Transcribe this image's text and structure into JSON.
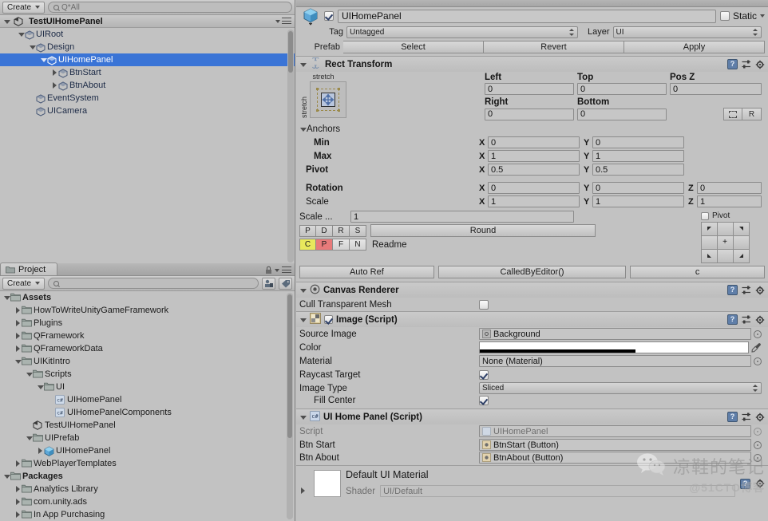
{
  "hierarchy": {
    "create_label": "Create",
    "search_placeholder": "Q*All",
    "root_label": "TestUIHomePanel",
    "items": [
      {
        "label": "UIRoot",
        "depth": 1,
        "arrow": "down",
        "selected": false,
        "icon": "gameobject"
      },
      {
        "label": "Design",
        "depth": 2,
        "arrow": "down",
        "selected": false,
        "icon": "gameobject"
      },
      {
        "label": "UIHomePanel",
        "depth": 3,
        "arrow": "down",
        "selected": true,
        "icon": "gameobject"
      },
      {
        "label": "BtnStart",
        "depth": 4,
        "arrow": "right",
        "selected": false,
        "icon": "gameobject"
      },
      {
        "label": "BtnAbout",
        "depth": 4,
        "arrow": "right",
        "selected": false,
        "icon": "gameobject"
      },
      {
        "label": "EventSystem",
        "depth": 2,
        "arrow": "none",
        "selected": false,
        "icon": "gameobject"
      },
      {
        "label": "UICamera",
        "depth": 2,
        "arrow": "none",
        "selected": false,
        "icon": "gameobject"
      }
    ]
  },
  "project": {
    "tab_label": "Project",
    "create_label": "Create",
    "search_placeholder": "",
    "items": [
      {
        "label": "Assets",
        "depth": 0,
        "arrow": "down",
        "icon": "folder",
        "bold": true
      },
      {
        "label": "HowToWriteUnityGameFramework",
        "depth": 1,
        "arrow": "right",
        "icon": "folder",
        "bold": false
      },
      {
        "label": "Plugins",
        "depth": 1,
        "arrow": "right",
        "icon": "folder",
        "bold": false
      },
      {
        "label": "QFramework",
        "depth": 1,
        "arrow": "right",
        "icon": "folder",
        "bold": false
      },
      {
        "label": "QFrameworkData",
        "depth": 1,
        "arrow": "right",
        "icon": "folder",
        "bold": false
      },
      {
        "label": "UIKitIntro",
        "depth": 1,
        "arrow": "down",
        "icon": "folder",
        "bold": false
      },
      {
        "label": "Scripts",
        "depth": 2,
        "arrow": "down",
        "icon": "folder",
        "bold": false
      },
      {
        "label": "UI",
        "depth": 3,
        "arrow": "down",
        "icon": "folder",
        "bold": false
      },
      {
        "label": "UIHomePanel",
        "depth": 4,
        "arrow": "none",
        "icon": "csharp",
        "bold": false
      },
      {
        "label": "UIHomePanelComponents",
        "depth": 4,
        "arrow": "none",
        "icon": "csharp",
        "bold": false
      },
      {
        "label": "TestUIHomePanel",
        "depth": 2,
        "arrow": "none",
        "icon": "scene",
        "bold": false
      },
      {
        "label": "UIPrefab",
        "depth": 2,
        "arrow": "down",
        "icon": "folder",
        "bold": false
      },
      {
        "label": "UIHomePanel",
        "depth": 3,
        "arrow": "right",
        "icon": "prefab",
        "bold": false
      },
      {
        "label": "WebPlayerTemplates",
        "depth": 1,
        "arrow": "right",
        "icon": "folder",
        "bold": false
      },
      {
        "label": "Packages",
        "depth": 0,
        "arrow": "down",
        "icon": "folder",
        "bold": true
      },
      {
        "label": "Analytics Library",
        "depth": 1,
        "arrow": "right",
        "icon": "folder",
        "bold": false
      },
      {
        "label": "com.unity.ads",
        "depth": 1,
        "arrow": "right",
        "icon": "folder",
        "bold": false
      },
      {
        "label": "In App Purchasing",
        "depth": 1,
        "arrow": "right",
        "icon": "folder",
        "bold": false
      }
    ]
  },
  "inspector": {
    "object_name": "UIHomePanel",
    "enabled": true,
    "static_label": "Static",
    "tag_label": "Tag",
    "tag_value": "Untagged",
    "layer_label": "Layer",
    "layer_value": "UI",
    "prefab_label": "Prefab",
    "prefab_buttons": [
      "Select",
      "Revert",
      "Apply"
    ],
    "rect_transform": {
      "title": "Rect Transform",
      "anchor_preset": "stretch",
      "anchor_preset_vertical": "stretch",
      "left_label": "Left",
      "left_value": "0",
      "top_label": "Top",
      "top_value": "0",
      "posz_label": "Pos Z",
      "posz_value": "0",
      "right_label": "Right",
      "right_value": "0",
      "bottom_label": "Bottom",
      "bottom_value": "0",
      "blueprint_label": "",
      "raw_label": "R",
      "anchors_label": "Anchors",
      "min_label": "Min",
      "min_x": "0",
      "min_y": "0",
      "max_label": "Max",
      "max_x": "1",
      "max_y": "1",
      "pivot_label": "Pivot",
      "pivot_x": "0.5",
      "pivot_y": "0.5",
      "rotation_label": "Rotation",
      "rot_x": "0",
      "rot_y": "0",
      "rot_z": "0",
      "scale_label": "Scale",
      "scale_x": "1",
      "scale_y": "1",
      "scale_z": "1"
    },
    "extra_tools": {
      "scale_label": "Scale ...",
      "scale_value": "1",
      "pdrs": [
        "P",
        "D",
        "R",
        "S"
      ],
      "round_label": "Round",
      "cpfn": [
        "C",
        "P",
        "F",
        "N"
      ],
      "readme_label": "Readme",
      "pivot_toggle_label": "Pivot",
      "auto_ref_label": "Auto Ref",
      "called_by_editor_label": "CalledByEditor()",
      "c_label": "c",
      "color_c": "#e8e85c",
      "color_p": "#e87a7a"
    },
    "canvas_renderer": {
      "title": "Canvas Renderer",
      "cull_label": "Cull Transparent Mesh",
      "cull_checked": false
    },
    "image_script": {
      "title": "Image (Script)",
      "enabled": true,
      "source_image_label": "Source Image",
      "source_image_value": "Background",
      "color_label": "Color",
      "color_value": "#FFFFFF",
      "material_label": "Material",
      "material_value": "None (Material)",
      "raycast_label": "Raycast Target",
      "raycast_checked": true,
      "image_type_label": "Image Type",
      "image_type_value": "Sliced",
      "fill_center_label": "Fill Center",
      "fill_center_checked": true
    },
    "ui_home_panel_script": {
      "title": "UI Home Panel (Script)",
      "script_label": "Script",
      "script_value": "UIHomePanel",
      "btn_start_label": "Btn Start",
      "btn_start_value": "BtnStart (Button)",
      "btn_about_label": "Btn About",
      "btn_about_value": "BtnAbout (Button)"
    },
    "material_footer": {
      "title": "Default UI Material",
      "shader_label": "Shader",
      "shader_value": "UI/Default"
    }
  },
  "watermark": {
    "cn_text": "凉鞋的笔记",
    "sub_text": "@51CTO博客"
  }
}
